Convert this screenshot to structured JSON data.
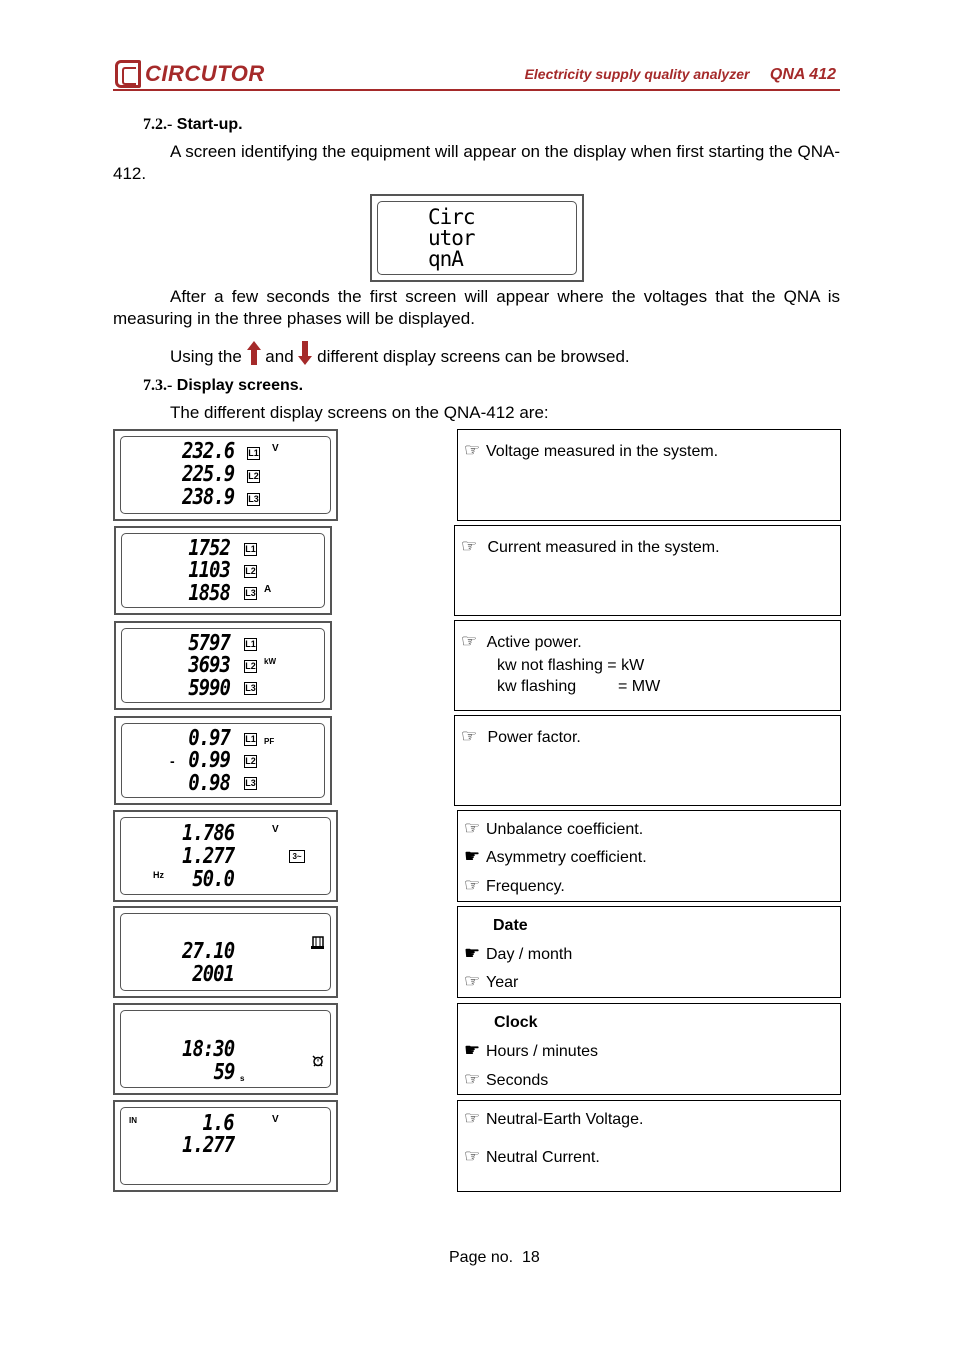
{
  "header": {
    "brand": "CIRCUTOR",
    "subtitle": "Electricity supply quality analyzer",
    "model": "QNA 412",
    "accent_color": "#a52a2a"
  },
  "section_72": {
    "number": "7.2.-",
    "title": "Start-up.",
    "paragraph": "A screen identifying the equipment will appear on the display when first starting the QNA-412.",
    "startup_lcd": [
      "Circ",
      "utor",
      "qnA"
    ],
    "after_paragraph": "After a few seconds the first screen will appear where the voltages that the QNA is measuring in the three phases will be displayed.",
    "browse_pre": "Using the",
    "browse_mid": "and",
    "browse_post": "different display screens can be browsed.",
    "up_arrow_icon": "up-arrow",
    "down_arrow_icon": "down-arrow"
  },
  "section_73": {
    "number": "7.3.-",
    "title": "Display screens.",
    "intro": "The different display screens on the QNA-412 are:"
  },
  "screens": [
    {
      "lcd": {
        "rows": [
          "232.6",
          "225.9",
          "238.9"
        ],
        "phases": [
          "L1",
          "L2",
          "L3"
        ],
        "unit": "V"
      },
      "desc": [
        "Voltage measured in the system."
      ]
    },
    {
      "lcd": {
        "rows": [
          "1752",
          "1103",
          "1858"
        ],
        "phases": [
          "L1",
          "L2",
          "L3"
        ],
        "unit": "A"
      },
      "desc": [
        "Current measured in the system."
      ]
    },
    {
      "lcd": {
        "rows": [
          "5797",
          "3693",
          "5990"
        ],
        "phases": [
          "L1",
          "L2",
          "L3"
        ],
        "unit": "kW"
      },
      "desc": [
        "Active power.",
        "kw not flashing = kW",
        "kw flashing",
        "= MW"
      ]
    },
    {
      "lcd": {
        "rows": [
          "0.97",
          "0.99",
          "0.98"
        ],
        "phases": [
          "L1",
          "L2",
          "L3"
        ],
        "unit": "PF",
        "sign_row2": "-"
      },
      "desc": [
        "Power factor."
      ]
    },
    {
      "lcd": {
        "rows": [
          "1.786",
          "1.277",
          "50.0"
        ],
        "unit": "V",
        "unit2": "Hz",
        "symbol": "3~"
      },
      "desc": [
        "Unbalance coefficient.",
        "Asymmetry coefficient.",
        "Frequency."
      ]
    },
    {
      "lcd": {
        "rows": [
          "27.10",
          "2001"
        ],
        "icon": "calendar"
      },
      "desc": [
        "Date",
        "Day / month",
        "Year"
      ]
    },
    {
      "lcd": {
        "rows": [
          "18:30",
          "59"
        ],
        "unit": "s",
        "icon": "alarm-clock"
      },
      "desc": [
        "Clock",
        "Hours / minutes",
        "Seconds"
      ]
    },
    {
      "lcd": {
        "rows": [
          "1.6",
          "1.277"
        ],
        "unit": "V",
        "label": "IN"
      },
      "desc": [
        "Neutral-Earth Voltage.",
        "Neutral Current."
      ]
    }
  ],
  "footer": {
    "label": "Page  no.",
    "page": "18"
  }
}
